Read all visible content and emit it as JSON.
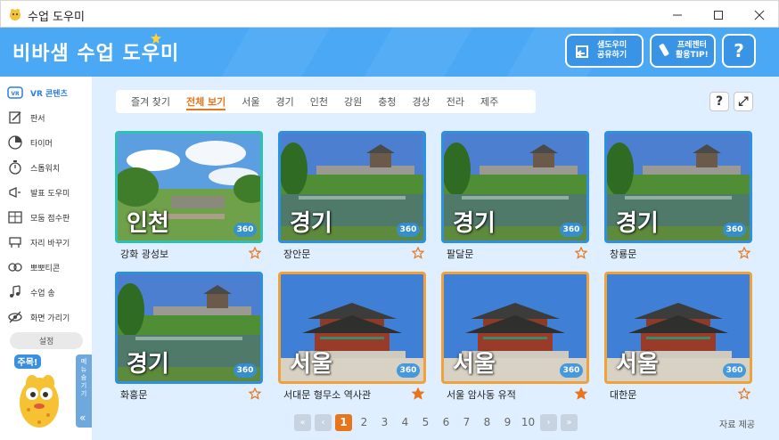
{
  "window": {
    "title": "수업 도우미"
  },
  "header": {
    "logo": "비바샘 수업 도우미",
    "buttons": [
      {
        "label_line1": "샘도우미",
        "label_line2": "공유하기",
        "icon": "share-icon"
      },
      {
        "label_line1": "프레젠터",
        "label_line2": "활용TIP!",
        "icon": "presenter-icon"
      },
      {
        "label": "?",
        "icon": "help-icon"
      }
    ]
  },
  "sidebar": {
    "items": [
      {
        "label": "VR 콘텐츠",
        "icon": "vr-icon",
        "active": true
      },
      {
        "label": "판서",
        "icon": "pen-icon"
      },
      {
        "label": "타이머",
        "icon": "timer-icon"
      },
      {
        "label": "스톱워치",
        "icon": "stopwatch-icon"
      },
      {
        "label": "발표 도우미",
        "icon": "megaphone-icon"
      },
      {
        "label": "모둠 점수판",
        "icon": "scoreboard-icon"
      },
      {
        "label": "자리 바꾸기",
        "icon": "seat-icon"
      },
      {
        "label": "뽀뽀티콘",
        "icon": "emoticon-icon"
      },
      {
        "label": "수업 송",
        "icon": "music-icon"
      },
      {
        "label": "화면 가리기",
        "icon": "hide-eye-icon"
      }
    ],
    "settings_label": "설정",
    "mascot_bubble": "주목!",
    "menu_hide_label": "메뉴 숨기기",
    "menu_hide_arrow": "«"
  },
  "tabs": [
    "즐겨 찾기",
    "전체 보기",
    "서울",
    "경기",
    "인천",
    "강원",
    "충청",
    "경상",
    "전라",
    "제주"
  ],
  "active_tab": 1,
  "tools": {
    "help": "?",
    "fullscreen": "⤢"
  },
  "cards": [
    {
      "title": "강화 광성보",
      "region": "인천",
      "badge": "360",
      "starred": false,
      "scene": "field",
      "frame": "green"
    },
    {
      "title": "장안문",
      "region": "경기",
      "badge": "360",
      "starred": false,
      "scene": "fortress",
      "frame": "blue"
    },
    {
      "title": "팔달문",
      "region": "경기",
      "badge": "360",
      "starred": false,
      "scene": "fortress",
      "frame": "blue"
    },
    {
      "title": "창룡문",
      "region": "경기",
      "badge": "360",
      "starred": false,
      "scene": "fortress",
      "frame": "blue"
    },
    {
      "title": "화홍문",
      "region": "경기",
      "badge": "360",
      "starred": false,
      "scene": "fortress",
      "frame": "blue"
    },
    {
      "title": "서대문 형무소 역사관",
      "region": "서울",
      "badge": "360",
      "starred": true,
      "scene": "palace",
      "frame": "orange"
    },
    {
      "title": "서울 암사동 유적",
      "region": "서울",
      "badge": "360",
      "starred": true,
      "scene": "palace",
      "frame": "orange"
    },
    {
      "title": "대한문",
      "region": "서울",
      "badge": "360",
      "starred": false,
      "scene": "palace",
      "frame": "orange"
    }
  ],
  "pagination": {
    "first": "«",
    "prev": "‹",
    "next": "›",
    "last": "»",
    "pages": [
      "1",
      "2",
      "3",
      "4",
      "5",
      "6",
      "7",
      "8",
      "9",
      "10"
    ],
    "current": "1"
  },
  "credit": "자료 제공",
  "colors": {
    "accent": "#e8751a",
    "header": "#4aa8f5",
    "main_bg": "#e0efff",
    "star": "#e8751a"
  }
}
